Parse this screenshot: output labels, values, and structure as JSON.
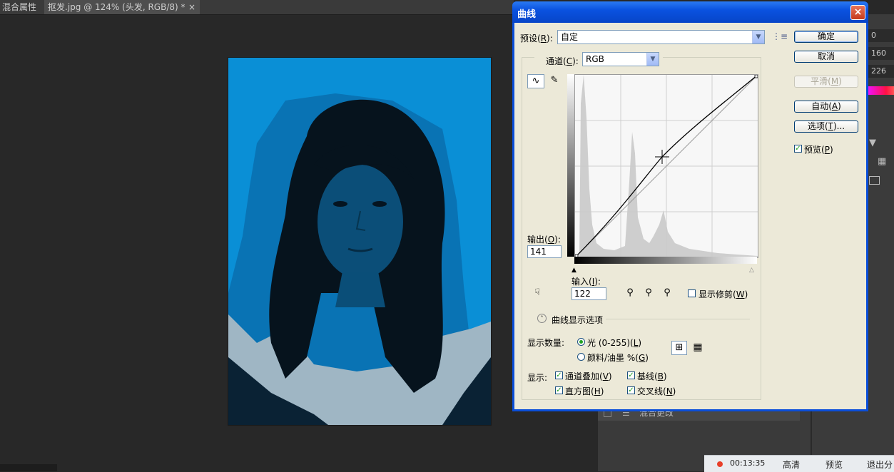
{
  "document_tabs": [
    {
      "label": "混合属性"
    },
    {
      "label": "抠发.jpg @ 124% (头发, RGB/8) *",
      "close": "×"
    }
  ],
  "right_panel_values": [
    "0",
    "160",
    "226"
  ],
  "layers_panel": {
    "row_label": "混合更改"
  },
  "recording_bar": {
    "time": "00:13:35",
    "buttons": [
      "高清",
      "预览",
      "退出分"
    ]
  },
  "dialog": {
    "title": "曲线",
    "close": "×",
    "preset": {
      "label": "预设(",
      "key": "R",
      "suffix": "):",
      "value": "自定"
    },
    "channel": {
      "label": "通道(",
      "key": "C",
      "suffix": "):",
      "value": "RGB"
    },
    "buttons": {
      "ok": {
        "label": "确定"
      },
      "cancel": {
        "label": "取消"
      },
      "smooth": {
        "label": "平滑(",
        "key": "M",
        "suffix": ")"
      },
      "auto": {
        "label": "自动(",
        "key": "A",
        "suffix": ")"
      },
      "options": {
        "label": "选项(",
        "key": "T",
        "suffix": ")..."
      }
    },
    "preview": {
      "label": "预览(",
      "key": "P",
      "suffix": ")",
      "checked": true
    },
    "output": {
      "label": "输出(",
      "key": "O",
      "suffix": "):",
      "value": "141"
    },
    "input": {
      "label": "输入(",
      "key": "I",
      "suffix": "):",
      "value": "122"
    },
    "show_clipping": {
      "label": "显示修剪(",
      "key": "W",
      "suffix": ")",
      "checked": false
    },
    "curve_display_options": {
      "label": "曲线显示选项"
    },
    "show_amount": {
      "label": "显示数量:",
      "light": {
        "label": "光 (0-255)(",
        "key": "L",
        "suffix": ")",
        "selected": true
      },
      "pigment": {
        "label": "颜料/油墨 %(",
        "key": "G",
        "suffix": ")",
        "selected": false
      }
    },
    "show": {
      "label": "显示:",
      "channel_overlays": {
        "label": "通道叠加(",
        "key": "V",
        "suffix": ")",
        "checked": true
      },
      "baseline": {
        "label": "基线(",
        "key": "B",
        "suffix": ")",
        "checked": true
      },
      "histogram": {
        "label": "直方图(",
        "key": "H",
        "suffix": ")",
        "checked": true
      },
      "intersection": {
        "label": "交叉线(",
        "key": "N",
        "suffix": ")",
        "checked": true
      }
    },
    "curve_point": {
      "input": 122,
      "output": 141
    }
  }
}
